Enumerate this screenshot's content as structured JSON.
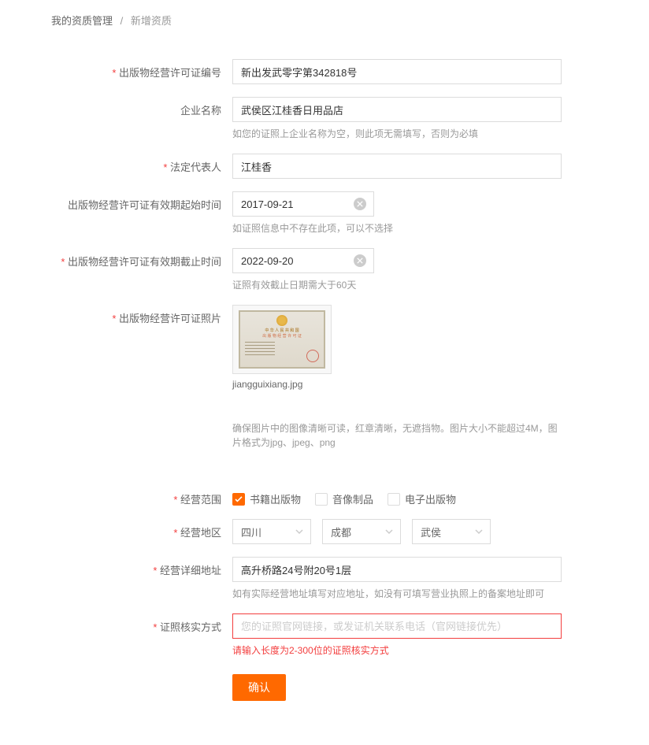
{
  "breadcrumb": {
    "parent": "我的资质管理",
    "current": "新增资质"
  },
  "form": {
    "license_number": {
      "label": "出版物经营许可证编号",
      "value": "新出发武零字第342818号"
    },
    "company_name": {
      "label": "企业名称",
      "value": "武侯区江桂香日用品店",
      "hint": "如您的证照上企业名称为空，则此项无需填写，否则为必填"
    },
    "legal_rep": {
      "label": "法定代表人",
      "value": "江桂香"
    },
    "start_date": {
      "label": "出版物经营许可证有效期起始时间",
      "value": "2017-09-21",
      "hint": "如证照信息中不存在此项，可以不选择"
    },
    "end_date": {
      "label": "出版物经营许可证有效期截止时间",
      "value": "2022-09-20",
      "hint": "证照有效截止日期需大于60天"
    },
    "photo": {
      "label": "出版物经营许可证照片",
      "filename": "jiangguixiang.jpg",
      "hint": "确保图片中的图像清晰可读，红章清晰，无遮挡物。图片大小不能超过4M，图片格式为jpg、jpeg、png"
    },
    "scope": {
      "label": "经营范围",
      "options": [
        {
          "label": "书籍出版物",
          "checked": true
        },
        {
          "label": "音像制品",
          "checked": false
        },
        {
          "label": "电子出版物",
          "checked": false
        }
      ]
    },
    "region": {
      "label": "经营地区",
      "province": "四川",
      "city": "成都",
      "district": "武侯"
    },
    "address": {
      "label": "经营详细地址",
      "value": "高升桥路24号附20号1层",
      "hint": "如有实际经营地址填写对应地址，如没有可填写营业执照上的备案地址即可"
    },
    "verify": {
      "label": "证照核实方式",
      "placeholder": "您的证照官网链接，或发证机关联系电话（官网链接优先）",
      "error": "请输入长度为2-300位的证照核实方式"
    },
    "submit_label": "确认"
  }
}
